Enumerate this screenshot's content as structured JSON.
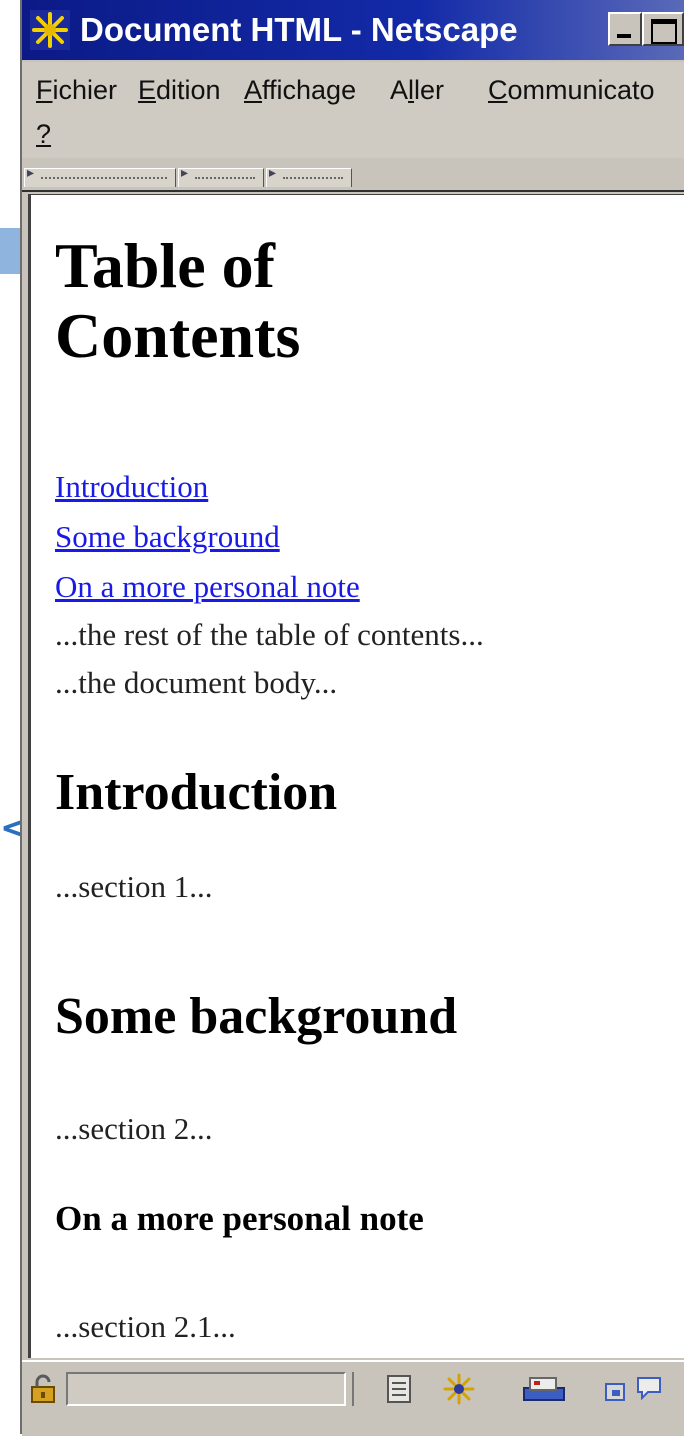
{
  "window": {
    "title": "Document HTML - Netscape"
  },
  "menu": {
    "items": [
      {
        "label": "Fichier",
        "accel": "F"
      },
      {
        "label": "Edition",
        "accel": "E"
      },
      {
        "label": "Affichage",
        "accel": "A"
      },
      {
        "label": "Aller",
        "accel": "l"
      },
      {
        "label": "Communicato",
        "accel": "C"
      },
      {
        "label": "?",
        "accel": "?"
      }
    ]
  },
  "document": {
    "toc_heading_line1": "Table of",
    "toc_heading_line2": "Contents",
    "toc_links": [
      "Introduction",
      "Some background",
      "On a more personal note"
    ],
    "toc_rest": "...the rest of the table of contents...",
    "body_note": "...the document body...",
    "sections": [
      {
        "heading": "Introduction",
        "text": "...section 1..."
      },
      {
        "heading": "Some background",
        "text": "...section 2..."
      },
      {
        "heading": "On a more personal note",
        "text": "...section 2.1..."
      }
    ]
  },
  "outside": {
    "arrow_glyph": "<"
  },
  "icons": {
    "app": "netscape-logo-icon",
    "security": "lock-icon",
    "status": [
      "document-icon",
      "navigator-icon",
      "mail-icon",
      "newsgroup-icon",
      "composer-icon"
    ]
  },
  "colors": {
    "titlebar": "#0b1a86",
    "link": "#1a1ae6",
    "chrome": "#c8c4bc"
  }
}
